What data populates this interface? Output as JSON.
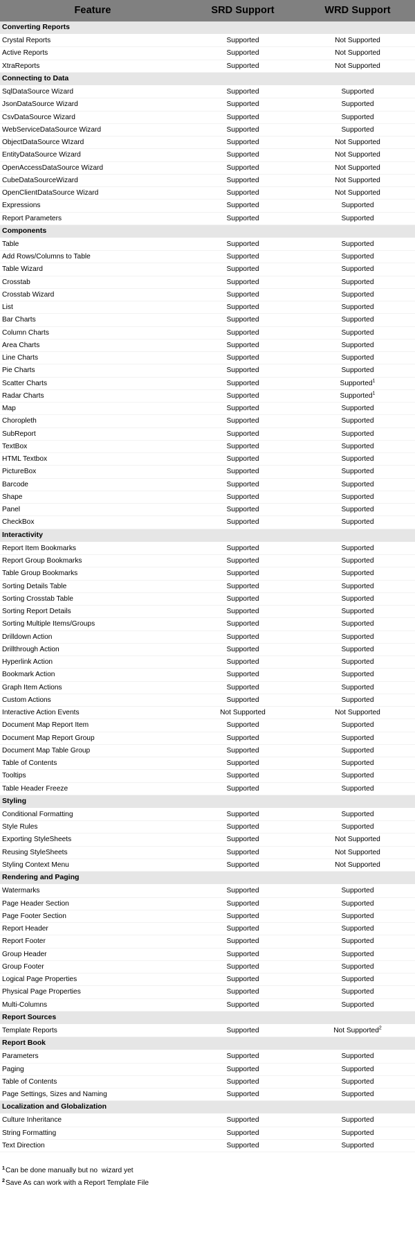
{
  "table": {
    "columns": [
      "Feature",
      "SRD Support",
      "WRD Support"
    ],
    "values": {
      "supported": "Supported",
      "not_supported": "Not Supported"
    },
    "sections": [
      {
        "title": "Converting Reports",
        "rows": [
          {
            "feature": "Crystal Reports",
            "srd": "Supported",
            "wrd": "Not Supported"
          },
          {
            "feature": "Active Reports",
            "srd": "Supported",
            "wrd": "Not Supported"
          },
          {
            "feature": "XtraReports",
            "srd": "Supported",
            "wrd": "Not Supported"
          }
        ]
      },
      {
        "title": "Connecting to Data",
        "rows": [
          {
            "feature": "SqlDataSource Wizard",
            "srd": "Supported",
            "wrd": "Supported"
          },
          {
            "feature": "JsonDataSource Wizard",
            "srd": "Supported",
            "wrd": "Supported"
          },
          {
            "feature": "CsvDataSource Wizard",
            "srd": "Supported",
            "wrd": "Supported"
          },
          {
            "feature": "WebServiceDataSource Wizard",
            "srd": "Supported",
            "wrd": "Supported"
          },
          {
            "feature": "ObjectDataSource WIzard",
            "srd": "Supported",
            "wrd": "Not Supported"
          },
          {
            "feature": "EntityDataSource Wizard",
            "srd": "Supported",
            "wrd": "Not Supported"
          },
          {
            "feature": "OpenAccessDataSource Wizard",
            "srd": "Supported",
            "wrd": "Not Supported"
          },
          {
            "feature": "CubeDataSourceWizard",
            "srd": "Supported",
            "wrd": "Not Supported"
          },
          {
            "feature": "OpenClientDataSource Wizard",
            "srd": "Supported",
            "wrd": "Not Supported"
          },
          {
            "feature": "Expressions",
            "srd": "Supported",
            "wrd": "Supported"
          },
          {
            "feature": "Report Parameters",
            "srd": "Supported",
            "wrd": "Supported"
          }
        ]
      },
      {
        "title": "Components",
        "rows": [
          {
            "feature": "Table",
            "srd": "Supported",
            "wrd": "Supported"
          },
          {
            "feature": "Add Rows/Columns to Table",
            "srd": "Supported",
            "wrd": "Supported"
          },
          {
            "feature": "Table Wizard",
            "srd": "Supported",
            "wrd": "Supported"
          },
          {
            "feature": "Crosstab",
            "srd": "Supported",
            "wrd": "Supported"
          },
          {
            "feature": "Crosstab Wizard",
            "srd": "Supported",
            "wrd": "Supported"
          },
          {
            "feature": "List",
            "srd": "Supported",
            "wrd": "Supported"
          },
          {
            "feature": "Bar Charts",
            "srd": "Supported",
            "wrd": "Supported"
          },
          {
            "feature": "Column Charts",
            "srd": "Supported",
            "wrd": "Supported"
          },
          {
            "feature": "Area Charts",
            "srd": "Supported",
            "wrd": "Supported"
          },
          {
            "feature": "Line Charts",
            "srd": "Supported",
            "wrd": "Supported"
          },
          {
            "feature": "Pie Charts",
            "srd": "Supported",
            "wrd": "Supported"
          },
          {
            "feature": "Scatter Charts",
            "srd": "Supported",
            "wrd": "Supported",
            "wrd_note": "1"
          },
          {
            "feature": "Radar Charts",
            "srd": "Supported",
            "wrd": "Supported",
            "wrd_note": "1"
          },
          {
            "feature": "Map",
            "srd": "Supported",
            "wrd": "Supported"
          },
          {
            "feature": "Choropleth",
            "srd": "Supported",
            "wrd": "Supported"
          },
          {
            "feature": "SubReport",
            "srd": "Supported",
            "wrd": "Supported"
          },
          {
            "feature": "TextBox",
            "srd": "Supported",
            "wrd": "Supported"
          },
          {
            "feature": "HTML Textbox",
            "srd": "Supported",
            "wrd": "Supported"
          },
          {
            "feature": "PictureBox",
            "srd": "Supported",
            "wrd": "Supported"
          },
          {
            "feature": "Barcode",
            "srd": "Supported",
            "wrd": "Supported"
          },
          {
            "feature": "Shape",
            "srd": "Supported",
            "wrd": "Supported"
          },
          {
            "feature": "Panel",
            "srd": "Supported",
            "wrd": "Supported"
          },
          {
            "feature": "CheckBox",
            "srd": "Supported",
            "wrd": "Supported"
          }
        ]
      },
      {
        "title": "Interactivity",
        "rows": [
          {
            "feature": "Report Item Bookmarks",
            "srd": "Supported",
            "wrd": "Supported"
          },
          {
            "feature": "Report Group Bookmarks",
            "srd": "Supported",
            "wrd": "Supported"
          },
          {
            "feature": "Table Group Bookmarks",
            "srd": "Supported",
            "wrd": "Supported"
          },
          {
            "feature": "Sorting Details Table",
            "srd": "Supported",
            "wrd": "Supported"
          },
          {
            "feature": "Sorting Crosstab Table",
            "srd": "Supported",
            "wrd": "Supported"
          },
          {
            "feature": "Sorting Report Details",
            "srd": "Supported",
            "wrd": "Supported"
          },
          {
            "feature": "Sorting Multiple Items/Groups",
            "srd": "Supported",
            "wrd": "Supported"
          },
          {
            "feature": "Drilldown Action",
            "srd": "Supported",
            "wrd": "Supported"
          },
          {
            "feature": "Drillthrough Action",
            "srd": "Supported",
            "wrd": "Supported"
          },
          {
            "feature": "Hyperlink Action",
            "srd": "Supported",
            "wrd": "Supported"
          },
          {
            "feature": "Bookmark Action",
            "srd": "Supported",
            "wrd": "Supported"
          },
          {
            "feature": "Graph Item Actions",
            "srd": "Supported",
            "wrd": "Supported"
          },
          {
            "feature": "Custom Actions",
            "srd": "Supported",
            "wrd": "Supported"
          },
          {
            "feature": "Interactive Action Events",
            "srd": "Not Supported",
            "wrd": "Not Supported"
          },
          {
            "feature": "Document Map Report Item",
            "srd": "Supported",
            "wrd": "Supported"
          },
          {
            "feature": "Document Map Report Group",
            "srd": "Supported",
            "wrd": "Supported"
          },
          {
            "feature": "Document Map Table Group",
            "srd": "Supported",
            "wrd": "Supported"
          },
          {
            "feature": "Table of Contents",
            "srd": "Supported",
            "wrd": "Supported"
          },
          {
            "feature": "Tooltips",
            "srd": "Supported",
            "wrd": "Supported"
          },
          {
            "feature": "Table Header Freeze",
            "srd": "Supported",
            "wrd": "Supported"
          }
        ]
      },
      {
        "title": "Styling",
        "rows": [
          {
            "feature": "Conditional Formatting",
            "srd": "Supported",
            "wrd": "Supported"
          },
          {
            "feature": "Style Rules",
            "srd": "Supported",
            "wrd": "Supported"
          },
          {
            "feature": "Exporting StyleSheets",
            "srd": "Supported",
            "wrd": "Not Supported"
          },
          {
            "feature": "Reusing StyleSheets",
            "srd": "Supported",
            "wrd": "Not Supported"
          },
          {
            "feature": "Styling Context Menu",
            "srd": "Supported",
            "wrd": "Not Supported"
          }
        ]
      },
      {
        "title": "Rendering and Paging",
        "rows": [
          {
            "feature": "Watermarks",
            "srd": "Supported",
            "wrd": "Supported"
          },
          {
            "feature": "Page Header Section",
            "srd": "Supported",
            "wrd": "Supported"
          },
          {
            "feature": "Page Footer Section",
            "srd": "Supported",
            "wrd": "Supported"
          },
          {
            "feature": "Report Header",
            "srd": "Supported",
            "wrd": "Supported"
          },
          {
            "feature": "Report Footer",
            "srd": "Supported",
            "wrd": "Supported"
          },
          {
            "feature": "Group Header",
            "srd": "Supported",
            "wrd": "Supported"
          },
          {
            "feature": "Group Footer",
            "srd": "Supported",
            "wrd": "Supported"
          },
          {
            "feature": "Logical Page Properties",
            "srd": "Supported",
            "wrd": "Supported"
          },
          {
            "feature": "Physical Page Properties",
            "srd": "Supported",
            "wrd": "Supported"
          },
          {
            "feature": "Multi-Columns",
            "srd": "Supported",
            "wrd": "Supported"
          }
        ]
      },
      {
        "title": "Report Sources",
        "rows": [
          {
            "feature": "Template Reports",
            "srd": "Supported",
            "wrd": "Not Supported",
            "wrd_note": "2"
          }
        ]
      },
      {
        "title": "Report Book",
        "rows": [
          {
            "feature": "Parameters",
            "srd": "Supported",
            "wrd": "Supported"
          },
          {
            "feature": "Paging",
            "srd": "Supported",
            "wrd": "Supported"
          },
          {
            "feature": "Table of Contents",
            "srd": "Supported",
            "wrd": "Supported"
          },
          {
            "feature": "Page Settings, Sizes and Naming",
            "srd": "Supported",
            "wrd": "Supported"
          }
        ]
      },
      {
        "title": "Localization and Globalization",
        "rows": [
          {
            "feature": "Culture Inheritance",
            "srd": "Supported",
            "wrd": "Supported"
          },
          {
            "feature": "String Formatting",
            "srd": "Supported",
            "wrd": "Supported"
          },
          {
            "feature": "Text Direction",
            "srd": "Supported",
            "wrd": "Supported"
          }
        ]
      }
    ]
  },
  "footnotes": [
    {
      "marker": "1",
      "text": "Can be done manually but no  wizard yet"
    },
    {
      "marker": "2",
      "text": "Save As can work with a Report Template File"
    }
  ],
  "colors": {
    "header_bg": "#808080",
    "section_bg": "#e6e6e6",
    "row_bg": "#ffffff",
    "text": "#000000"
  }
}
